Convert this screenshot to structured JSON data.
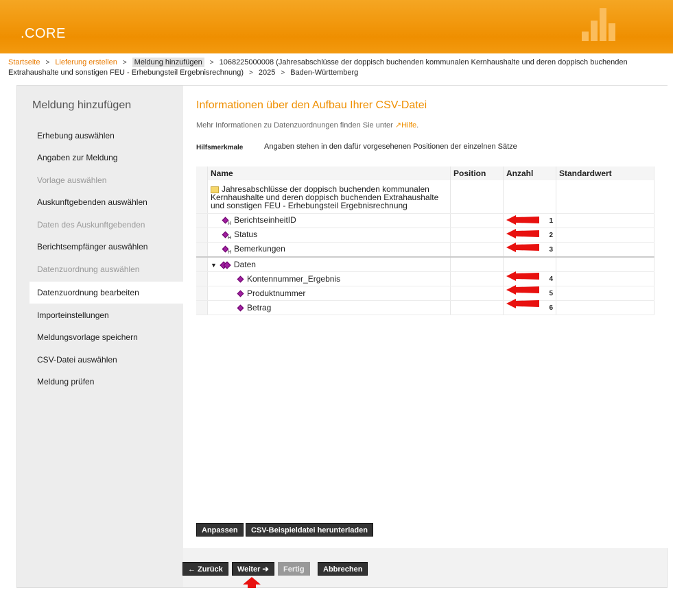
{
  "app": {
    "title": ".CORE"
  },
  "breadcrumb": {
    "items": [
      "Startseite",
      "Lieferung erstellen",
      "Meldung hinzufügen",
      "1068225000008 (Jahresabschlüsse der doppisch buchenden kommunalen Kernhaushalte und deren doppisch buchenden Extrahaushalte und sonstigen FEU - Erhebungsteil Ergebnisrechnung)",
      "2025",
      "Baden-Württemberg"
    ],
    "separator": ">"
  },
  "sidebar": {
    "title": "Meldung hinzufügen",
    "items": [
      {
        "label": "Erhebung auswählen",
        "state": "enabled"
      },
      {
        "label": "Angaben zur Meldung",
        "state": "enabled"
      },
      {
        "label": "Vorlage auswählen",
        "state": "disabled"
      },
      {
        "label": "Auskunftgebenden auswählen",
        "state": "enabled"
      },
      {
        "label": "Daten des Auskunftgebenden",
        "state": "disabled"
      },
      {
        "label": "Berichtsempfänger auswählen",
        "state": "enabled"
      },
      {
        "label": "Datenzuordnung auswählen",
        "state": "disabled"
      },
      {
        "label": "Datenzuordnung bearbeiten",
        "state": "active"
      },
      {
        "label": "Importeinstellungen",
        "state": "enabled"
      },
      {
        "label": "Meldungsvorlage speichern",
        "state": "enabled"
      },
      {
        "label": "CSV-Datei auswählen",
        "state": "enabled"
      },
      {
        "label": "Meldung prüfen",
        "state": "enabled"
      }
    ]
  },
  "main": {
    "title": "Informationen über den Aufbau Ihrer CSV-Datei",
    "info_prefix": "Mehr Informationen zu Datenzuordnungen finden Sie unter ",
    "help_link": "Hilfe",
    "help_suffix": ".",
    "hilfs_label": "Hilfsmerkmale",
    "hilfs_text": "Angaben stehen in den dafür vorgesehenen Positionen der einzelnen Sätze",
    "table": {
      "headers": [
        "Name",
        "Position",
        "Anzahl",
        "Standardwert"
      ],
      "root": "Jahresabschlüsse der doppisch buchenden kommunalen Kernhaushalte und deren doppisch buchenden Extrahaushalte und sonstigen FEU - Erhebungsteil Ergebnisrechnung",
      "rows": [
        {
          "name": "BerichtseinheitID",
          "anzahl": "1",
          "kind": "hilfs"
        },
        {
          "name": "Status",
          "anzahl": "2",
          "kind": "hilfs"
        },
        {
          "name": "Bemerkungen",
          "anzahl": "3",
          "kind": "hilfs"
        },
        {
          "name": "Daten",
          "anzahl": "",
          "kind": "group"
        },
        {
          "name": "Kontennummer_Ergebnis",
          "anzahl": "4",
          "kind": "data"
        },
        {
          "name": "Produktnummer",
          "anzahl": "5",
          "kind": "data"
        },
        {
          "name": "Betrag",
          "anzahl": "6",
          "kind": "data"
        }
      ],
      "hilfs_subscript": "H"
    },
    "buttons": {
      "anpassen": "Anpassen",
      "csv_download": "CSV-Beispieldatei herunterladen"
    }
  },
  "footer_buttons": {
    "back": "← Zurück",
    "next": "Weiter ➔",
    "finish": "Fertig",
    "cancel": "Abbrechen"
  },
  "colors": {
    "accent": "#ef8f00",
    "annotation_arrow": "#e8110f"
  }
}
